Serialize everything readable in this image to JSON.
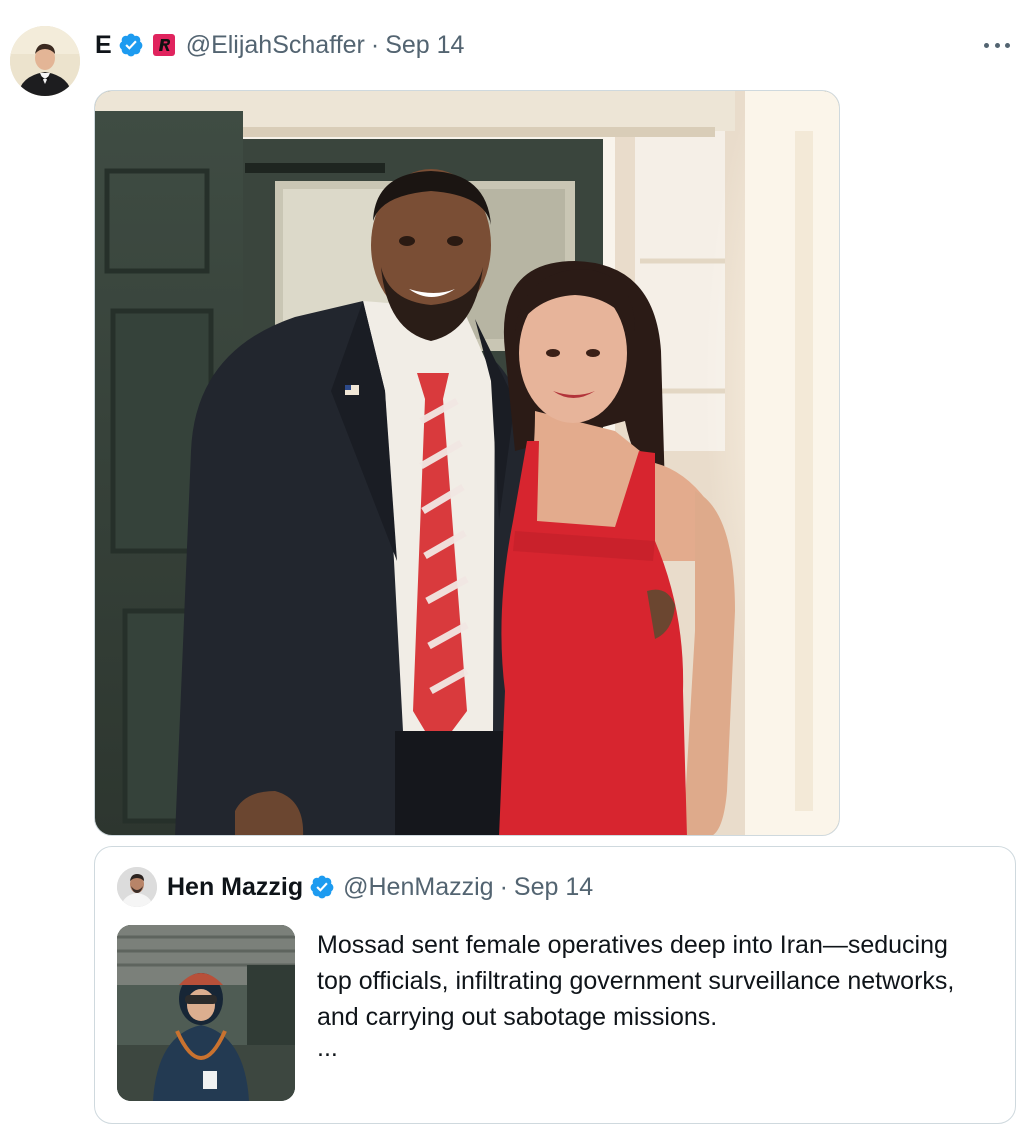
{
  "tweet": {
    "author_name": "E",
    "handle": "@ElijahSchaffer",
    "separator": "·",
    "date": "Sep 14",
    "icons": {
      "verified": "verified-badge-icon",
      "brand": "red-r-logo-icon",
      "more": "more-options-icon"
    },
    "colors": {
      "verified_blue": "#1d9bf0",
      "brand_red": "#e0245e",
      "secondary_text": "#536471"
    },
    "media_alt": "Photo of a man in a dark suit with a red striped tie and a woman in a red dress"
  },
  "quote": {
    "author_name": "Hen Mazzig",
    "handle": "@HenMazzig",
    "separator": "·",
    "date": "Sep 14",
    "text": "Mossad sent female operatives deep into Iran—seducing top officials, infiltrating government surveillance networks, and carrying out sabotage missions.",
    "ellipsis": "..."
  }
}
